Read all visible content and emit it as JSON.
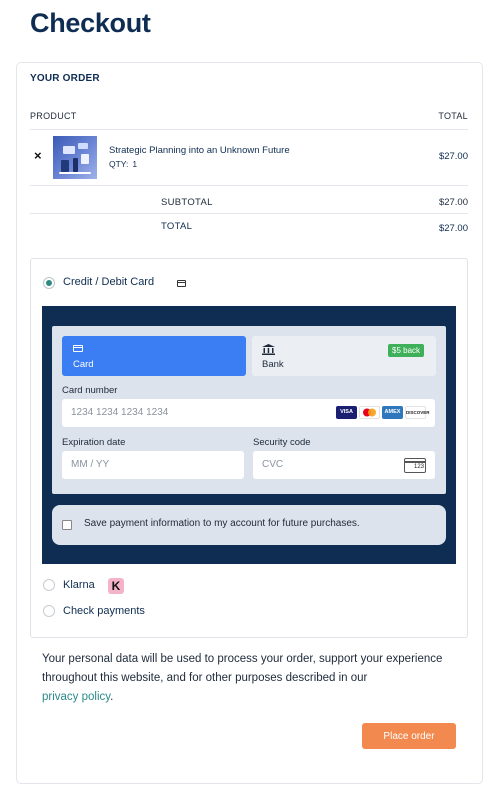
{
  "page_title": "Checkout",
  "order": {
    "heading": "YOUR ORDER",
    "col_product": "PRODUCT",
    "col_total": "TOTAL",
    "item": {
      "remove_symbol": "×",
      "name": "Strategic Planning into an Unknown Future",
      "qty_label": "QTY:",
      "qty": "1",
      "price": "$27.00"
    },
    "subtotal_label": "SUBTOTAL",
    "subtotal": "$27.00",
    "total_label": "TOTAL",
    "total": "$27.00"
  },
  "payment": {
    "methods": [
      {
        "label": "Credit / Debit Card",
        "selected": true
      },
      {
        "label": "Klarna",
        "selected": false
      },
      {
        "label": "Check payments",
        "selected": false
      }
    ],
    "tabs": {
      "card_label": "Card",
      "bank_label": "Bank",
      "bank_badge": "$5 back"
    },
    "card_number_label": "Card number",
    "card_number_placeholder": "1234 1234 1234 1234",
    "expiry_label": "Expiration date",
    "expiry_placeholder": "MM / YY",
    "cvc_label": "Security code",
    "cvc_placeholder": "CVC",
    "cvc_icon_text": "123",
    "brands": [
      "VISA",
      "mastercard",
      "AMEX",
      "DISCOVER"
    ],
    "save_label": "Save payment information to my account for future purchases.",
    "klarna_logo_letter": "K"
  },
  "privacy": {
    "text": "Your personal data will be used to process your order, support your experience throughout this website, and for other purposes described in our",
    "link": "privacy policy",
    "end": "."
  },
  "place_order_label": "Place order",
  "colors": {
    "navy": "#0f2d52",
    "card_tab_blue": "#3b7df2",
    "badge_green": "#3eb05a",
    "radio_teal": "#2f8a83",
    "button_orange": "#f2894e",
    "klarna_pink": "#f5b3c9"
  }
}
